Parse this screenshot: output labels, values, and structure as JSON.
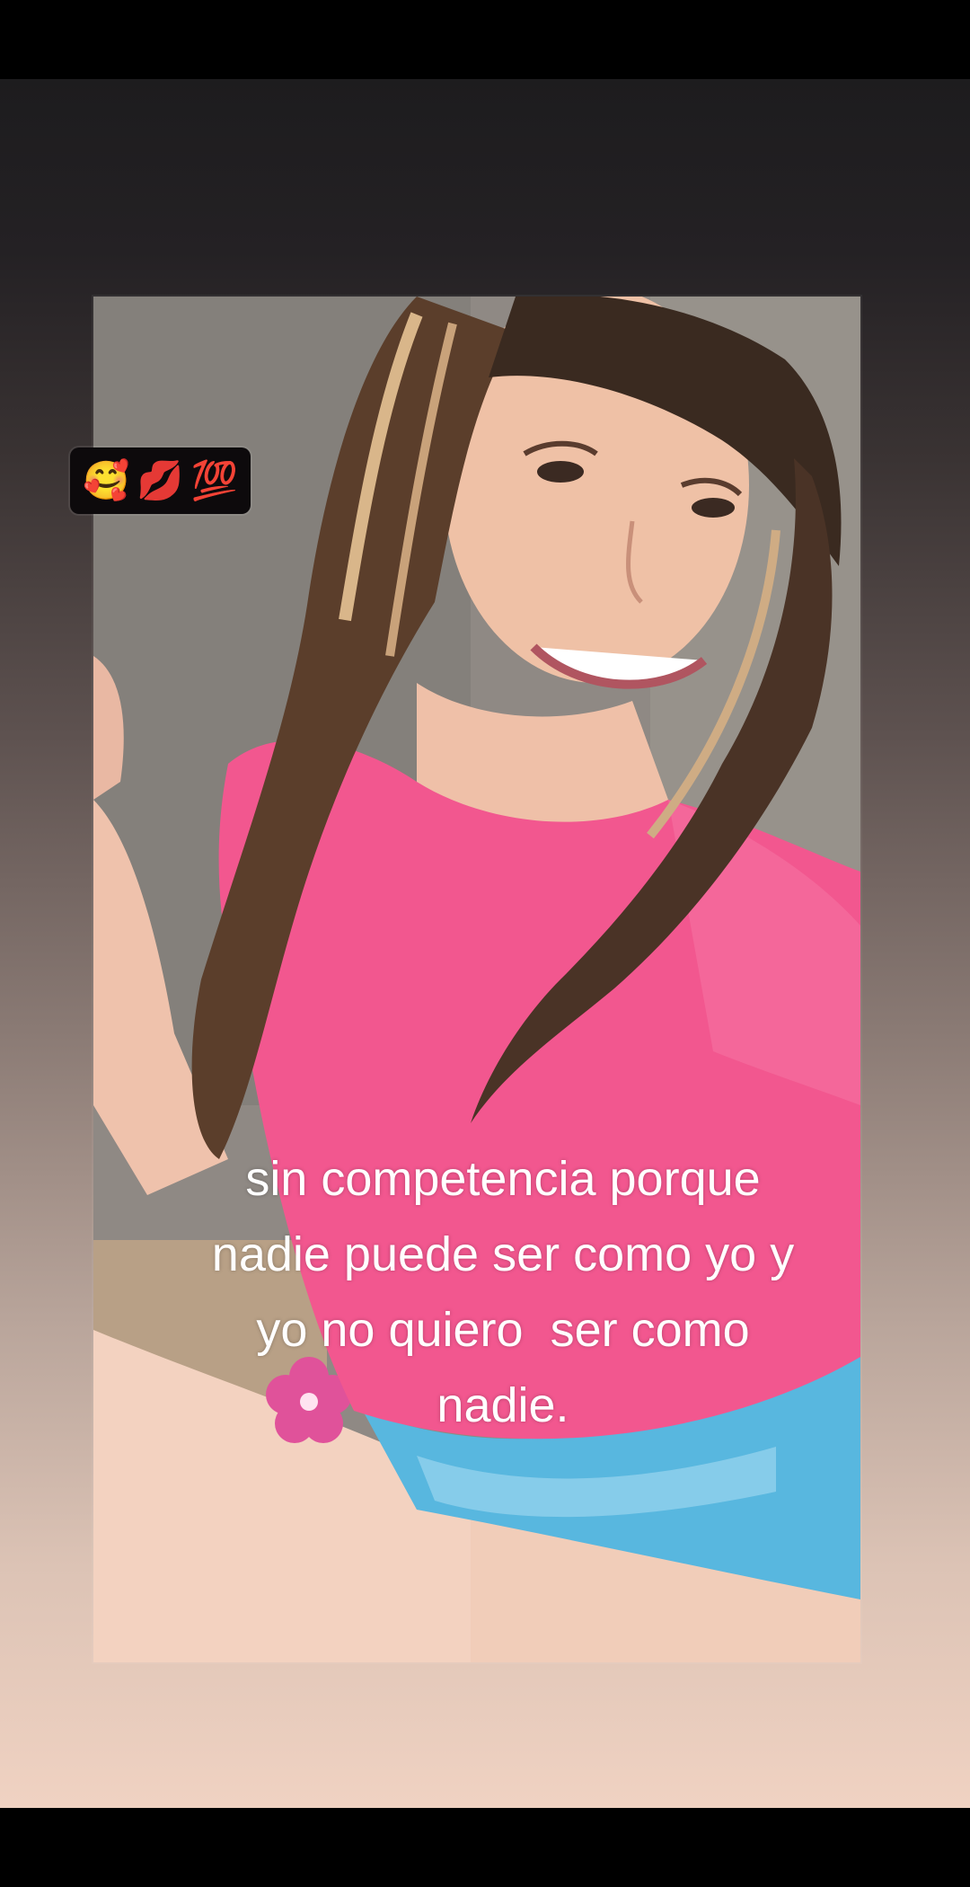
{
  "story": {
    "sticker": {
      "emojis": [
        "🥰",
        "💋",
        "💯"
      ],
      "icon_names": [
        "smiling-face-with-hearts-icon",
        "kiss-mark-icon",
        "hundred-points-icon"
      ]
    },
    "caption_lines": [
      "sin competencia porque",
      "nadie puede ser como yo y",
      "yo no quiero  ser como",
      "nadie."
    ]
  },
  "colors": {
    "shirt": "#f2578f",
    "background_top": "#1d1c1e",
    "background_bottom": "#f0d2c2"
  }
}
